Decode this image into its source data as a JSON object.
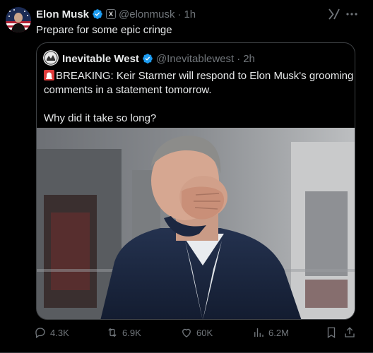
{
  "post": {
    "author": {
      "name": "Elon Musk",
      "handle": "@elonmusk",
      "separator": "·",
      "time": "1h"
    },
    "text": "Prepare for some epic cringe",
    "quoted": {
      "author": {
        "name": "Inevitable West",
        "handle": "@Inevitablewest",
        "separator": "·",
        "time": "2h"
      },
      "lines": [
        "BREAKING: Keir Starmer will respond to Elon Musk's grooming gang",
        "comments in a statement tomorrow.",
        "",
        "Why did it take so long?"
      ],
      "emoji": "siren-icon"
    },
    "stats": {
      "replies": "4.3K",
      "reposts": "6.9K",
      "likes": "60K",
      "views": "6.2M"
    }
  },
  "colors": {
    "background": "#000000",
    "text": "#e7e9ea",
    "muted": "#71767b",
    "verified": "#1d9bf0",
    "border": "#3e4144"
  },
  "icons": [
    "verified-badge-icon",
    "x-affiliate-badge-icon",
    "grok-icon",
    "more-icon",
    "reply-icon",
    "repost-icon",
    "like-icon",
    "views-icon",
    "bookmark-icon",
    "share-icon"
  ]
}
